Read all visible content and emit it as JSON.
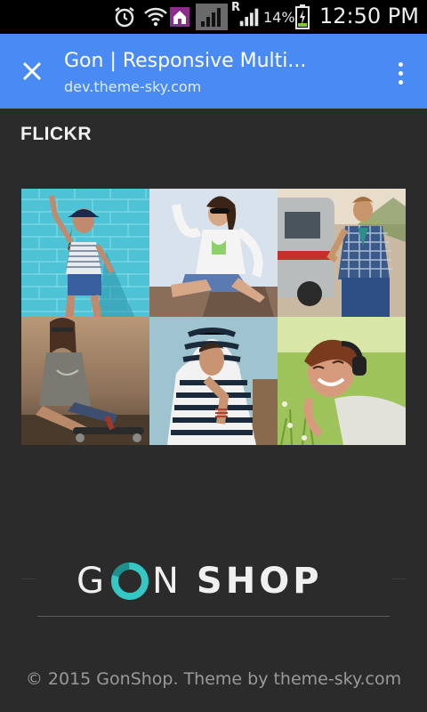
{
  "status_bar": {
    "time": "12:50 PM",
    "battery_percent": "14%",
    "roaming_label": "R",
    "icons": [
      "alarm-icon",
      "wifi-icon",
      "home-icon",
      "signal-icon",
      "signal-bars-icon",
      "battery-charging-icon"
    ]
  },
  "toolbar": {
    "title": "Gon | Responsive Multi...",
    "url": "dev.theme-sky.com",
    "close_icon": "close-icon",
    "menu_icon": "more-vertical-icon",
    "color": "#4a8af4"
  },
  "flickr": {
    "title": "FLICKR",
    "photos": [
      {
        "alt": "Woman in cap against blue brick wall"
      },
      {
        "alt": "Woman in sunglasses seated on deck"
      },
      {
        "alt": "Man in checked shirt beside trailer"
      },
      {
        "alt": "Woman on skateboard at sunset"
      },
      {
        "alt": "Man in striped hoodie"
      },
      {
        "alt": "Woman with headphones lying in grass"
      }
    ]
  },
  "footer": {
    "logo": {
      "part1": "G",
      "part2": "N",
      "part3": "SHOP",
      "ring_color": "#35c7c4"
    },
    "copyright": "© 2015 GonShop. Theme by theme-sky.com"
  },
  "colors": {
    "page_background": "#2b2b2b",
    "accent": "#35c7c4"
  }
}
